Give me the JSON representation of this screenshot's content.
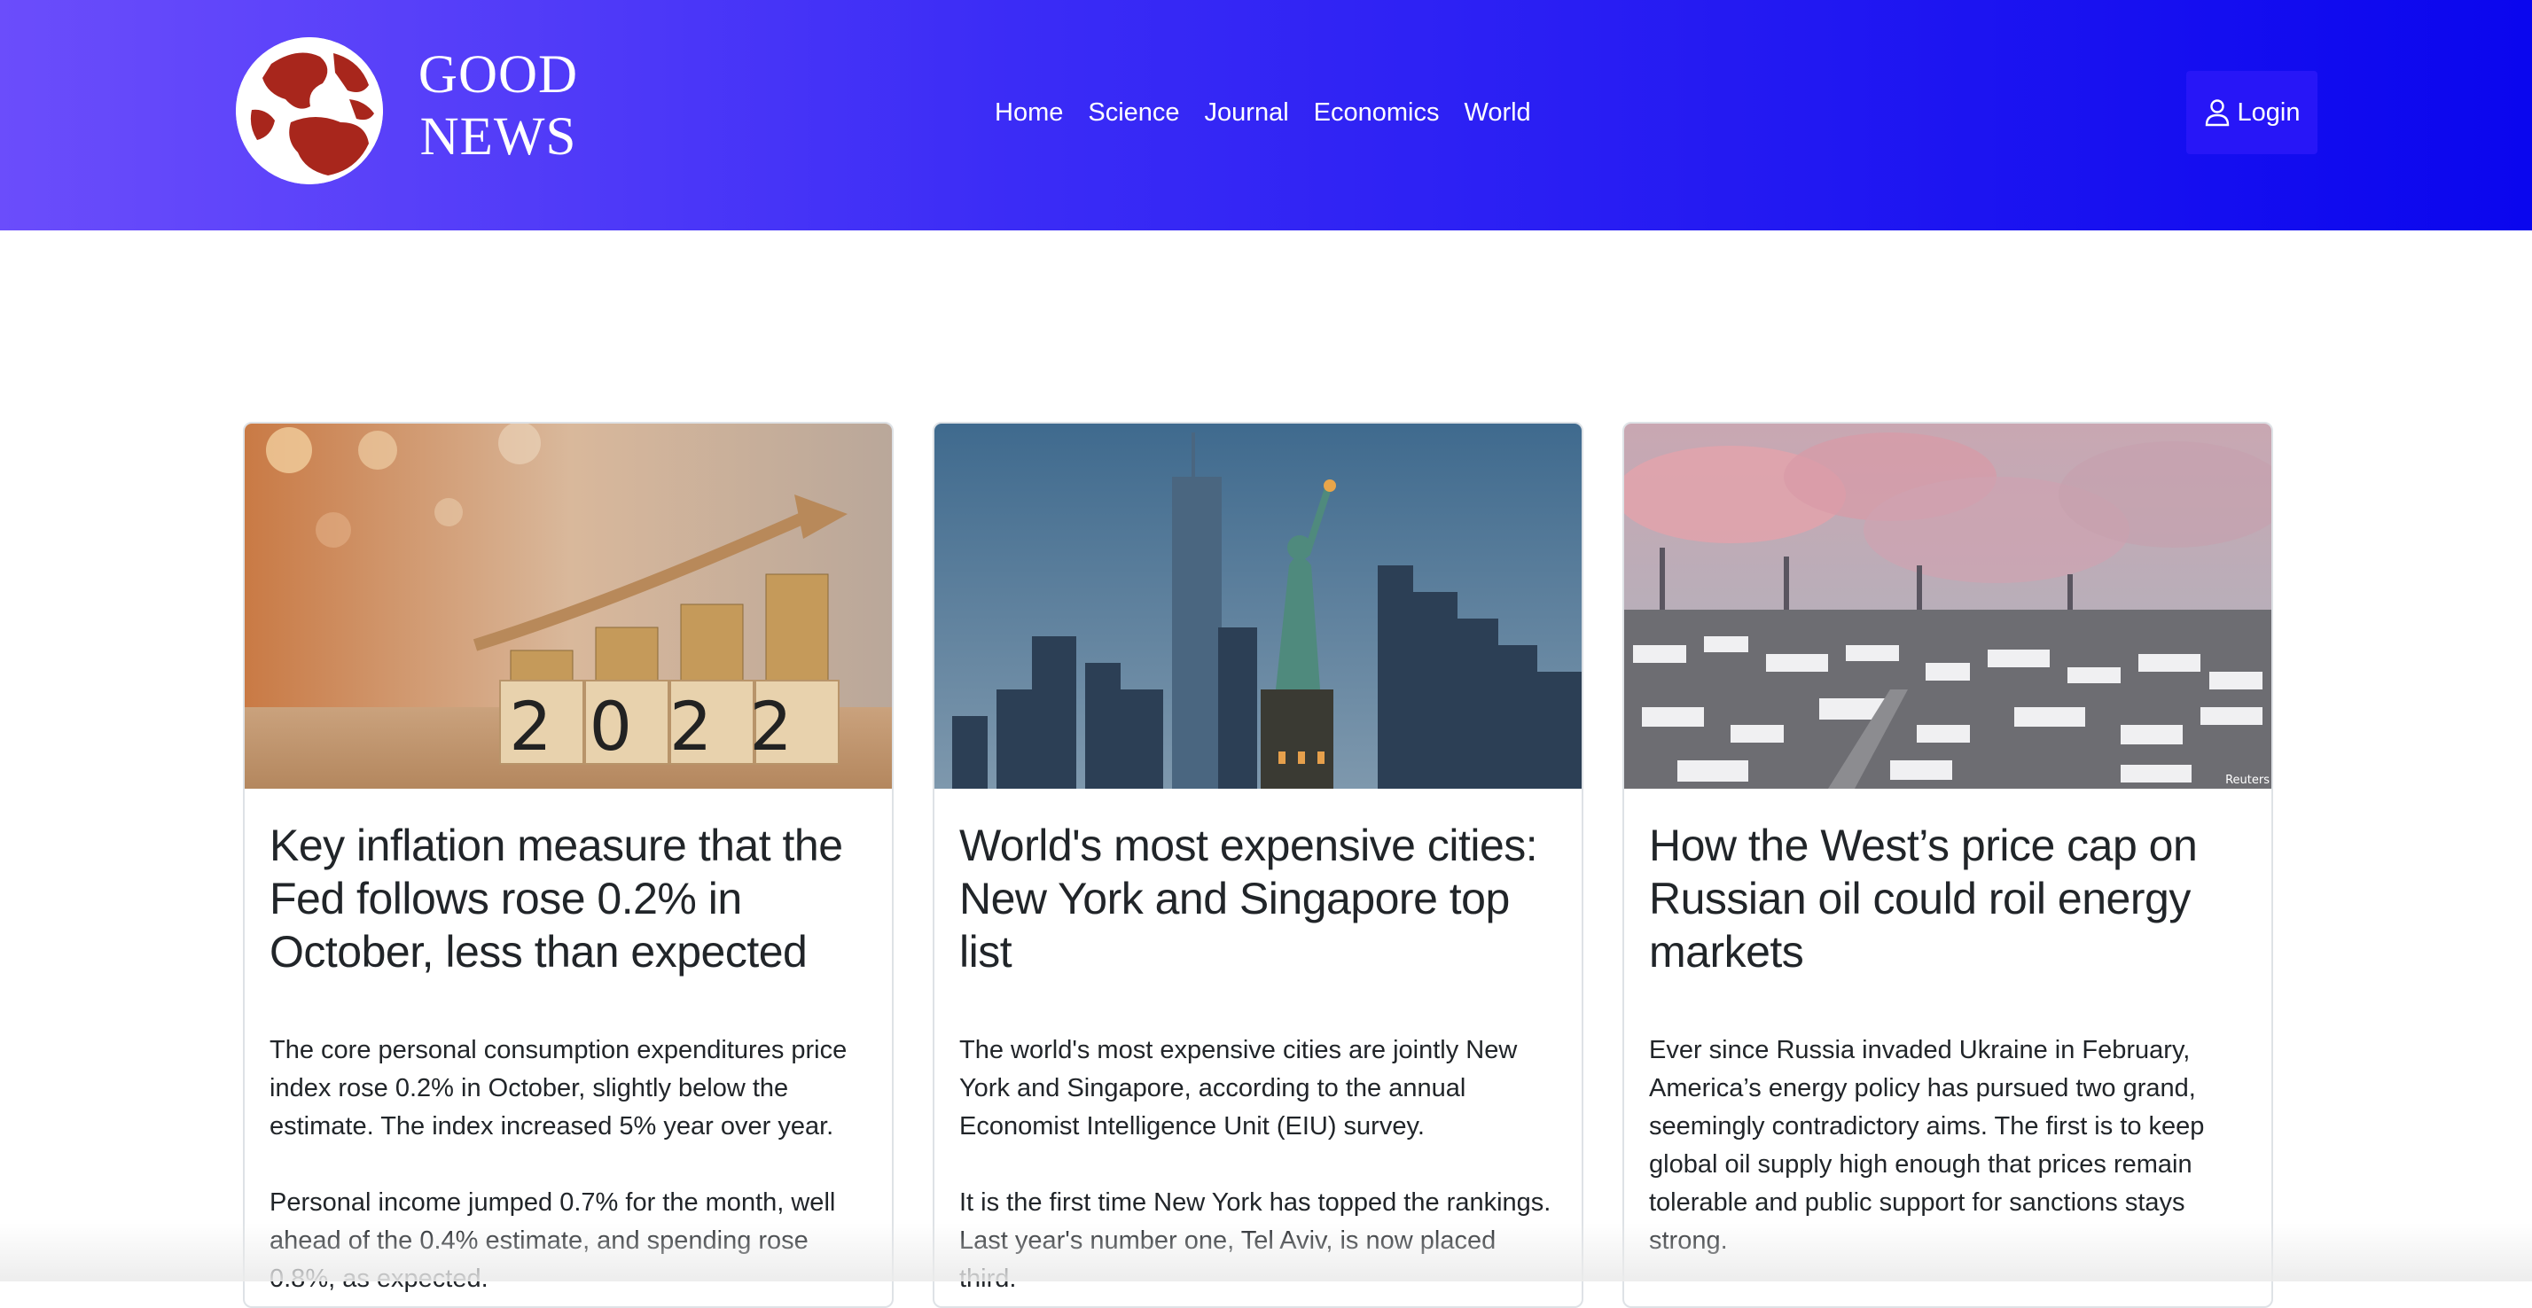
{
  "brand": {
    "line1": "GOOD",
    "line2": "NEWS"
  },
  "nav": {
    "items": [
      {
        "label": "Home"
      },
      {
        "label": "Science"
      },
      {
        "label": "Journal"
      },
      {
        "label": "Economics"
      },
      {
        "label": "World"
      }
    ]
  },
  "login": {
    "label": "Login",
    "icon": "person-icon"
  },
  "colors": {
    "header_start": "#6b4dfb",
    "header_end": "#0a06ee",
    "globe_land": "#a8261c"
  },
  "cards": [
    {
      "image": "wooden-blocks-2022-coins",
      "image_text": "2022",
      "title": "Key inflation measure that the Fed follows rose 0.2% in October, less than expected",
      "paragraphs": [
        "The core personal consumption expenditures price index rose 0.2% in October, slightly below the estimate. The index increased 5% year over year.",
        "Personal income jumped 0.7% for the month, well ahead of the 0.4% estimate, and spending rose 0.8%, as expected."
      ]
    },
    {
      "image": "new-york-skyline-statue-of-liberty",
      "title": "World's most expensive cities: New York and Singapore top list",
      "paragraphs": [
        "The world's most expensive cities are jointly New York and Singapore, according to the annual Economist Intelligence Unit (EIU) survey.",
        "It is the first time New York has topped the rankings. Last year's number one, Tel Aviv, is now placed third."
      ]
    },
    {
      "image": "industrial-smoke-snowy-town",
      "image_caption": "Reuters",
      "title": "How the West’s price cap on Russian oil could roil energy markets",
      "paragraphs": [
        "Ever since Russia invaded Ukraine in February, America’s energy policy has pursued two grand, seemingly contradictory aims. The first is to keep global oil supply high enough that prices remain tolerable and public support for sanctions stays strong."
      ]
    }
  ]
}
